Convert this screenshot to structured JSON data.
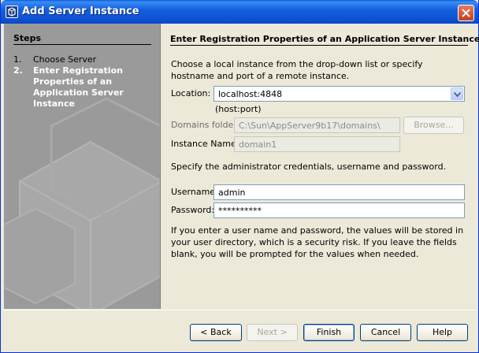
{
  "window": {
    "title": "Add Server Instance"
  },
  "steps": {
    "heading": "Steps",
    "items": [
      {
        "num": "1.",
        "label": "Choose Server"
      },
      {
        "num": "2.",
        "label": "Enter Registration Properties of an Application Server Instance"
      }
    ]
  },
  "content": {
    "title": "Enter Registration Properties of an Application Server Instance",
    "intro": "Choose a local instance from the drop-down list or specify hostname and port of a remote instance.",
    "location_label": "Location:",
    "location_value": "localhost:4848",
    "location_hint": "(host:port)",
    "domains_label": "Domains folder:",
    "domains_value": "C:\\Sun\\AppServer9b17\\domains\\",
    "browse_label": "Browse...",
    "instance_label": "Instance Name:",
    "instance_value": "domain1",
    "credentials_text": "Specify the administrator credentials, username and password.",
    "username_label": "Username:",
    "username_value": "admin",
    "password_label": "Password:",
    "password_value": "**********",
    "warning_text": "If you enter a user name and password, the values will be stored in your user directory, which is a security risk. If you leave the fields blank, you will be prompted for the values when needed."
  },
  "buttons": {
    "back": "< Back",
    "next": "Next >",
    "finish": "Finish",
    "cancel": "Cancel",
    "help": "Help"
  },
  "colors": {
    "titlebar": "#0b4fd0",
    "steps_bg": "#9c9c9c",
    "dialog_bg": "#ece9d8"
  }
}
